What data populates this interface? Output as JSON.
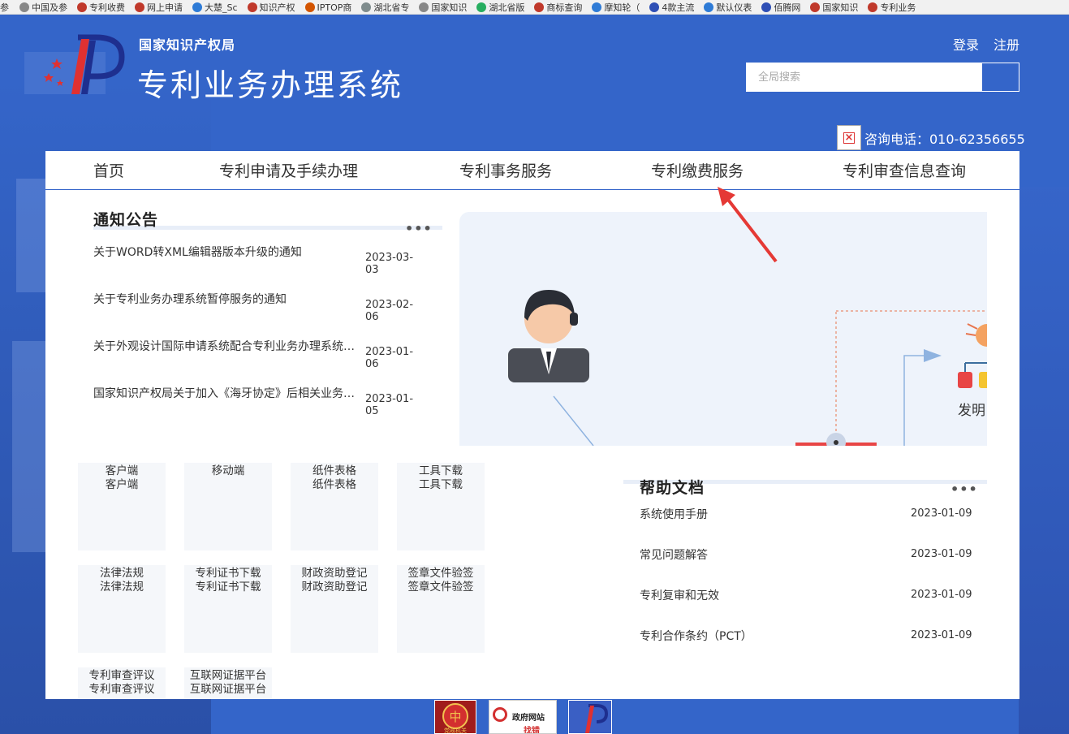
{
  "bookmarks": [
    {
      "label": "中国及参",
      "color": "#888888"
    },
    {
      "label": "专利收费",
      "color": "#c0392b"
    },
    {
      "label": "网上申请",
      "color": "#c0392b"
    },
    {
      "label": "大楚_Sc",
      "color": "#2e7bd6"
    },
    {
      "label": "知识产权",
      "color": "#c0392b"
    },
    {
      "label": "IPTOP商",
      "color": "#d35400"
    },
    {
      "label": "湖北省专",
      "color": "#7f8c8d"
    },
    {
      "label": "国家知识",
      "color": "#888888"
    },
    {
      "label": "湖北省版",
      "color": "#27ae60"
    },
    {
      "label": "商标查询",
      "color": "#c0392b"
    },
    {
      "label": "摩知轮（",
      "color": "#2e7bd6"
    },
    {
      "label": "4款主流",
      "color": "#2e4fb5"
    },
    {
      "label": "默认仪表",
      "color": "#2e7bd6"
    },
    {
      "label": "佰腾网",
      "color": "#2e4fb5"
    },
    {
      "label": "国家知识",
      "color": "#c0392b"
    },
    {
      "label": "专利业务",
      "color": "#c0392b"
    }
  ],
  "bookmark_lead": "参",
  "header": {
    "org_name": "国家知识产权局",
    "system_name": "专利业务办理系统",
    "login": "登录",
    "register": "注册",
    "search_placeholder": "全局搜索",
    "hotline": "咨询电话：010-62356655"
  },
  "nav": {
    "items": [
      "首页",
      "专利申请及手续办理",
      "专利事务服务",
      "专利缴费服务",
      "专利审查信息查询"
    ]
  },
  "notices": {
    "title": "通知公告",
    "more": "•••",
    "items": [
      {
        "title": "关于WORD转XML编辑器版本升级的通知",
        "date": "2023-03-03"
      },
      {
        "title": "关于专利业务办理系统暂停服务的通知",
        "date": "2023-02-06"
      },
      {
        "title": "关于外观设计国际申请系统配合专利业务办理系统升级的通知",
        "date": "2023-01-06"
      },
      {
        "title": "国家知识产权局关于加入《海牙协定》后相关业务办理的通知",
        "date": "2023-01-05"
      }
    ]
  },
  "banner": {
    "label": "发明"
  },
  "tiles": [
    {
      "line1": "客户端",
      "line2": "客户端"
    },
    {
      "line1": "移动端",
      "line2": ""
    },
    {
      "line1": "纸件表格",
      "line2": "纸件表格"
    },
    {
      "line1": "工具下载",
      "line2": "工具下载"
    },
    {
      "line1": "法律法规",
      "line2": "法律法规"
    },
    {
      "line1": "专利证书下载",
      "line2": "专利证书下载"
    },
    {
      "line1": "财政资助登记",
      "line2": "财政资助登记"
    },
    {
      "line1": "签章文件验签",
      "line2": "签章文件验签"
    },
    {
      "line1": "专利审查评议",
      "line2": "专利审查评议"
    },
    {
      "line1": "互联网证据平台",
      "line2": "互联网证据平台"
    }
  ],
  "help": {
    "title": "帮助文档",
    "more": "•••",
    "items": [
      {
        "title": "系统使用手册",
        "date": "2023-01-09"
      },
      {
        "title": "常见问题解答",
        "date": "2023-01-09"
      },
      {
        "title": "专利复审和无效",
        "date": "2023-01-09"
      },
      {
        "title": "专利合作条约（PCT）",
        "date": "2023-01-09"
      }
    ]
  },
  "footer": {
    "gov_badge_line1": "政府网站",
    "gov_badge_line2": "找错",
    "party_badge": "党政机关"
  },
  "colors": {
    "brand_blue": "#3465c9",
    "arrow_red": "#e53935"
  }
}
